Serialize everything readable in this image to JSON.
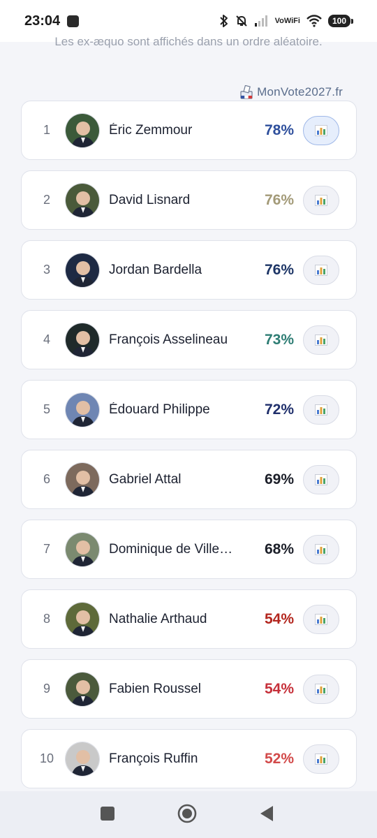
{
  "status_bar": {
    "time": "23:04",
    "vowifi_top": "Vo",
    "vowifi_bottom": "WiFi",
    "battery": "100",
    "icons": [
      "notification-square-icon",
      "bluetooth-icon",
      "bell-off-icon",
      "cell-signal-icon",
      "vowifi-icon",
      "wifi-icon",
      "battery-icon"
    ]
  },
  "header": {
    "tie_note": "Les ex-æquo sont affichés dans un ordre aléatoire.",
    "brand": "MonVote2027.fr",
    "brand_icon": "ballot-box-icon"
  },
  "candidates": [
    {
      "rank": "1",
      "name": "Éric Zemmour",
      "percent": "78%",
      "color": "#2e4f9c",
      "avatar_color": "#3b5a3a",
      "active": true
    },
    {
      "rank": "2",
      "name": "David Lisnard",
      "percent": "76%",
      "color": "#a39a78",
      "avatar_color": "#4a5a3a",
      "active": false
    },
    {
      "rank": "3",
      "name": "Jordan Bardella",
      "percent": "76%",
      "color": "#1d3566",
      "avatar_color": "#1e2a44",
      "active": false
    },
    {
      "rank": "4",
      "name": "François Asselineau",
      "percent": "73%",
      "color": "#2e7d74",
      "avatar_color": "#1f2a2a",
      "active": false
    },
    {
      "rank": "5",
      "name": "Édouard Philippe",
      "percent": "72%",
      "color": "#1f2f6b",
      "avatar_color": "#6f86b3",
      "active": false
    },
    {
      "rank": "6",
      "name": "Gabriel Attal",
      "percent": "69%",
      "color": "#1b1e28",
      "avatar_color": "#7d6a5d",
      "active": false
    },
    {
      "rank": "7",
      "name": "Dominique de Ville…",
      "percent": "68%",
      "color": "#1b1e28",
      "avatar_color": "#7b8a70",
      "active": false
    },
    {
      "rank": "8",
      "name": "Nathalie Arthaud",
      "percent": "54%",
      "color": "#b3261e",
      "avatar_color": "#5e6a3a",
      "active": false
    },
    {
      "rank": "9",
      "name": "Fabien Roussel",
      "percent": "54%",
      "color": "#c6303a",
      "avatar_color": "#4b5a3c",
      "active": false
    },
    {
      "rank": "10",
      "name": "François Ruffin",
      "percent": "52%",
      "color": "#d24a4a",
      "avatar_color": "#c9c9c9",
      "active": false
    }
  ],
  "nav_bar": {
    "buttons": [
      "recents-square-icon",
      "home-circle-icon",
      "back-triangle-icon"
    ]
  }
}
